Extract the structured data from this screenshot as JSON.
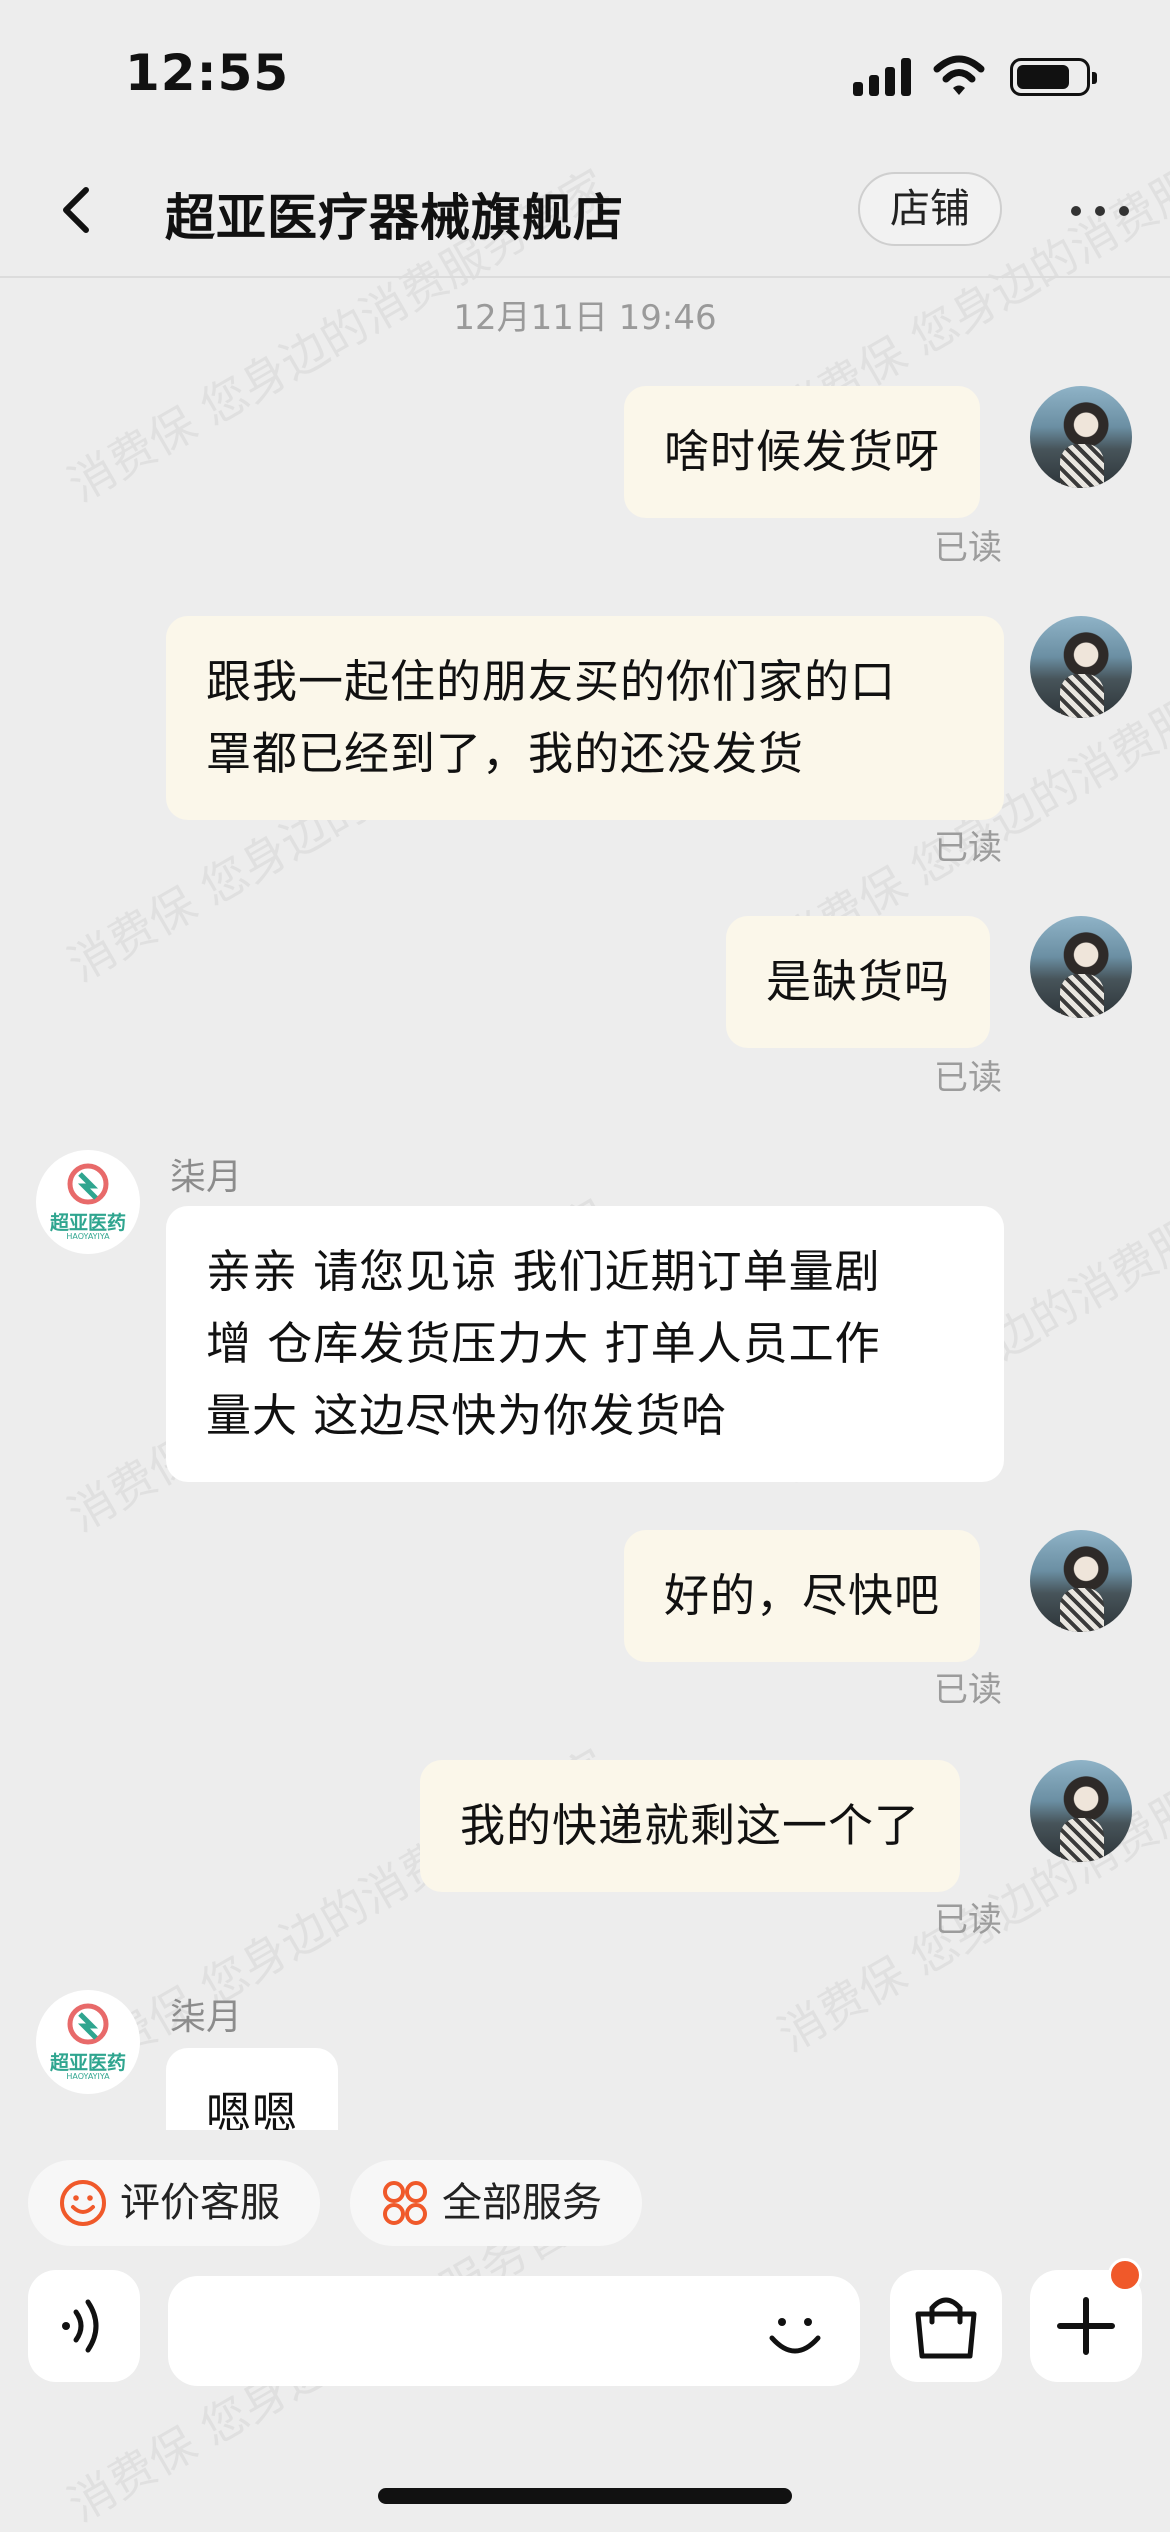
{
  "status_bar": {
    "time": "12:55"
  },
  "header": {
    "title": "超亚医疗器械旗舰店",
    "store_button": "店铺"
  },
  "chat": {
    "timestamp": "12月11日 19:46",
    "read_label": "已读",
    "messages": [
      {
        "from": "me",
        "lines": [
          "啥时候发货呀"
        ]
      },
      {
        "from": "me",
        "lines": [
          "跟我一起住的朋友买的你们家的口",
          "罩都已经到了，我的还没发货"
        ]
      },
      {
        "from": "me",
        "lines": [
          "是缺货吗"
        ]
      },
      {
        "from": "shop",
        "sender": "柒月",
        "lines": [
          "亲亲 请您见谅 我们近期订单量剧",
          "增 仓库发货压力大 打单人员工作",
          "量大 这边尽快为你发货哈"
        ]
      },
      {
        "from": "me",
        "lines": [
          "好的，尽快吧"
        ]
      },
      {
        "from": "me",
        "lines": [
          "我的快递就剩这一个了"
        ]
      },
      {
        "from": "shop",
        "sender": "柒月",
        "lines": [
          "嗯嗯"
        ]
      }
    ]
  },
  "shop_avatar_text": {
    "top": "超亚医药",
    "bottom": "HAOYAYIYA"
  },
  "services": {
    "rate_label": "评价客服",
    "all_label": "全部服务"
  },
  "input": {
    "placeholder": ""
  },
  "watermark": "消费保 您身边的消费服务管家",
  "colors": {
    "accent": "#f0592a",
    "outgoing_bubble": "#fbf7ea",
    "incoming_bubble": "#ffffff",
    "background": "#ededed"
  },
  "icons": [
    "back-icon",
    "more-icon",
    "smile-icon",
    "grid-icon",
    "voice-icon",
    "emoji-icon",
    "bag-icon",
    "plus-icon"
  ]
}
